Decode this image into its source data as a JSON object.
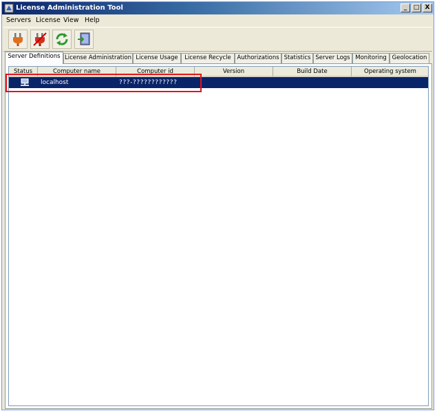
{
  "window": {
    "title": "License Administration Tool",
    "buttons": {
      "minimize": "_",
      "maximize": "□",
      "close": "X"
    }
  },
  "menu": [
    "Servers",
    "License",
    "View",
    "Help"
  ],
  "toolbar": {
    "icons": [
      "connect-plug-icon",
      "disconnect-plug-icon",
      "refresh-icon",
      "login-icon"
    ]
  },
  "tabs": [
    "Server Definitions",
    "License Administration",
    "License Usage",
    "License Recycle",
    "Authorizations",
    "Statistics",
    "Server Logs",
    "Monitoring",
    "Geolocation"
  ],
  "active_tab": "Server Definitions",
  "table": {
    "columns": [
      "Status",
      "Computer name",
      "Computer id",
      "Version",
      "Build Date",
      "Operating system"
    ],
    "rows": [
      {
        "status_icon": "computer-icon",
        "computer_name": "localhost",
        "computer_id": "???-????????????",
        "version": "",
        "build_date": "",
        "operating_system": ""
      }
    ]
  },
  "colors": {
    "selection": "#0a246a",
    "highlight_box": "#e0141c",
    "titlebar_start": "#0a246a",
    "titlebar_end": "#a6caf0"
  }
}
